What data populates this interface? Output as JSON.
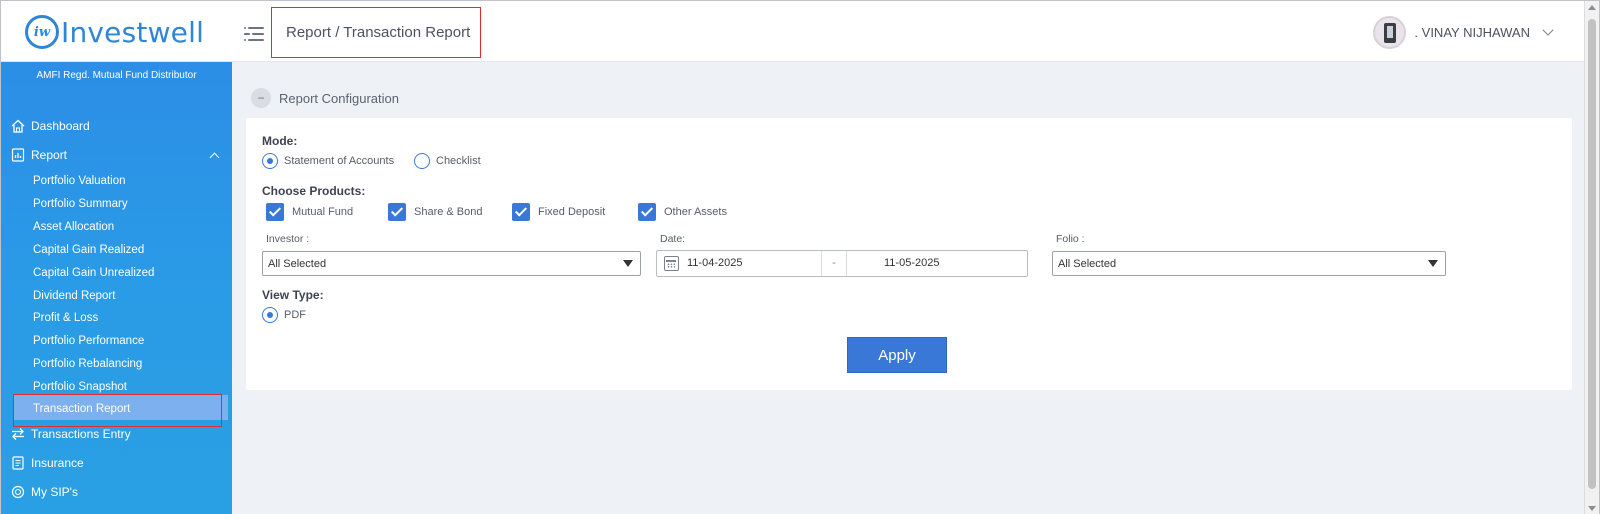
{
  "brand": {
    "logo_mark": "iw",
    "name": "Investwell",
    "color": "#2f86d8"
  },
  "header": {
    "breadcrumb": "Report / Transaction Report",
    "user_name": ". VINAY NIJHAWAN"
  },
  "sidebar": {
    "tagline": "AMFI Regd. Mutual Fund Distributor",
    "nav": [
      {
        "label": "Dashboard",
        "icon": "home-icon"
      },
      {
        "label": "Report",
        "icon": "report-icon",
        "expanded": true
      },
      {
        "label": "Transactions Entry",
        "icon": "swap-arrows-icon"
      },
      {
        "label": "Insurance",
        "icon": "document-icon"
      },
      {
        "label": "My SIP's",
        "icon": "sip-icon"
      }
    ],
    "report_items": [
      "Portfolio Valuation",
      "Portfolio Summary",
      "Asset Allocation",
      "Capital Gain Realized",
      "Capital Gain Unrealized",
      "Dividend Report",
      "Profit & Loss",
      "Portfolio Performance",
      "Portfolio Rebalancing",
      "Portfolio Snapshot",
      "Transaction Report"
    ],
    "active_item": "Transaction Report"
  },
  "config": {
    "section_title": "Report Configuration",
    "collapse_symbol": "−",
    "mode_label": "Mode:",
    "mode_options": [
      "Statement of Accounts",
      "Checklist"
    ],
    "mode_selected": "Statement of Accounts",
    "products_label": "Choose Products:",
    "products": [
      "Mutual Fund",
      "Share & Bond",
      "Fixed Deposit",
      "Other Assets"
    ],
    "investor_label": "Investor :",
    "investor_value": "All Selected",
    "date_label": "Date:",
    "date_from": "11-04-2025",
    "date_separator": "-",
    "date_to": "11-05-2025",
    "folio_label": "Folio :",
    "folio_value": "All Selected",
    "view_type_label": "View Type:",
    "view_type": "PDF",
    "apply_label": "Apply"
  },
  "colors": {
    "sidebar_top": "#2c8ee6",
    "accent": "#3a78d8",
    "highlight_border": "#e02d2d",
    "active_item_bg": "#7cb0ef"
  }
}
